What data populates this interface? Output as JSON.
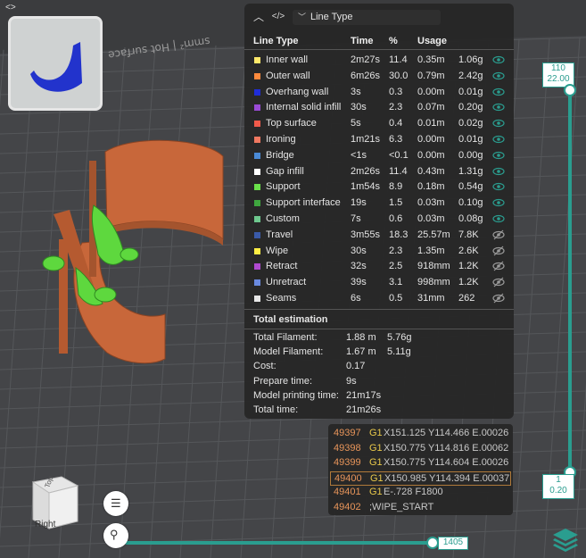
{
  "toolbar": {
    "expand_icon": "expand-icon"
  },
  "panel": {
    "dropdown_label": "Line Type",
    "headers": [
      "Line Type",
      "Time",
      "%",
      "Usage"
    ],
    "rows": [
      {
        "name": "Inner wall",
        "time": "2m27s",
        "pct": "11.4",
        "len": "0.35m",
        "weight": "1.06g",
        "color": "#ffe86a",
        "visible": true
      },
      {
        "name": "Outer wall",
        "time": "6m26s",
        "pct": "30.0",
        "len": "0.79m",
        "weight": "2.42g",
        "color": "#ff8a3d",
        "visible": true
      },
      {
        "name": "Overhang wall",
        "time": "3s",
        "pct": "0.3",
        "len": "0.00m",
        "weight": "0.01g",
        "color": "#1f2dd8",
        "visible": true
      },
      {
        "name": "Internal solid infill",
        "time": "30s",
        "pct": "2.3",
        "len": "0.07m",
        "weight": "0.20g",
        "color": "#9a4bd6",
        "visible": true
      },
      {
        "name": "Top surface",
        "time": "5s",
        "pct": "0.4",
        "len": "0.01m",
        "weight": "0.02g",
        "color": "#f05a4a",
        "visible": true
      },
      {
        "name": "Ironing",
        "time": "1m21s",
        "pct": "6.3",
        "len": "0.00m",
        "weight": "0.01g",
        "color": "#f07860",
        "visible": true
      },
      {
        "name": "Bridge",
        "time": "<1s",
        "pct": "<0.1",
        "len": "0.00m",
        "weight": "0.00g",
        "color": "#4a8ad6",
        "visible": true
      },
      {
        "name": "Gap infill",
        "time": "2m26s",
        "pct": "11.4",
        "len": "0.43m",
        "weight": "1.31g",
        "color": "#ffffff",
        "visible": true
      },
      {
        "name": "Support",
        "time": "1m54s",
        "pct": "8.9",
        "len": "0.18m",
        "weight": "0.54g",
        "color": "#6ae04a",
        "visible": true
      },
      {
        "name": "Support interface",
        "time": "19s",
        "pct": "1.5",
        "len": "0.03m",
        "weight": "0.10g",
        "color": "#3fa63f",
        "visible": true
      },
      {
        "name": "Custom",
        "time": "7s",
        "pct": "0.6",
        "len": "0.03m",
        "weight": "0.08g",
        "color": "#6ec88e",
        "visible": true
      },
      {
        "name": "Travel",
        "time": "3m55s",
        "pct": "18.3",
        "len": "25.57m",
        "weight": "7.8K",
        "color": "#3a5aa8",
        "visible": false
      },
      {
        "name": "Wipe",
        "time": "30s",
        "pct": "2.3",
        "len": "1.35m",
        "weight": "2.6K",
        "color": "#ffee44",
        "visible": false
      },
      {
        "name": "Retract",
        "time": "32s",
        "pct": "2.5",
        "len": "918mm",
        "weight": "1.2K",
        "color": "#b04ad0",
        "visible": false
      },
      {
        "name": "Unretract",
        "time": "39s",
        "pct": "3.1",
        "len": "998mm",
        "weight": "1.2K",
        "color": "#6a8ae0",
        "visible": false
      },
      {
        "name": "Seams",
        "time": "6s",
        "pct": "0.5",
        "len": "31mm",
        "weight": "262",
        "color": "#e8e8e8",
        "visible": false
      }
    ],
    "estimation_title": "Total estimation",
    "estimation": [
      {
        "label": "Total Filament:",
        "v1": "1.88 m",
        "v2": "5.76g"
      },
      {
        "label": "Model Filament:",
        "v1": "1.67 m",
        "v2": "5.11g"
      },
      {
        "label": "Cost:",
        "v1": "0.17",
        "v2": ""
      },
      {
        "label": "Prepare time:",
        "v1": "9s",
        "v2": ""
      },
      {
        "label": "Model printing time:",
        "v1": "21m17s",
        "v2": ""
      },
      {
        "label": "Total time:",
        "v1": "21m26s",
        "v2": ""
      }
    ]
  },
  "gcode": [
    {
      "line": "49397",
      "cmd": "G1",
      "args": "X151.125 Y114.466 E.00026",
      "selected": false
    },
    {
      "line": "49398",
      "cmd": "G1",
      "args": "X150.775 Y114.816 E.00062",
      "selected": false
    },
    {
      "line": "49399",
      "cmd": "G1",
      "args": "X150.775 Y114.604 E.00026",
      "selected": false
    },
    {
      "line": "49400",
      "cmd": "G1",
      "args": "X150.985 Y114.394 E.00037",
      "selected": true
    },
    {
      "line": "49401",
      "cmd": "G1",
      "args": "E-.728 F1800",
      "selected": false
    },
    {
      "line": "49402",
      "cmd": "",
      "args": ";WIPE_START",
      "selected": false
    }
  ],
  "vslider": {
    "top_layer": "110",
    "top_height": "22.00",
    "bottom_layer": "1",
    "bottom_height": "0.20"
  },
  "hslider": {
    "value": "1405"
  },
  "viewcube": {
    "front": "Right",
    "top": "Top"
  },
  "colors": {
    "accent": "#2a9d8f",
    "panel": "#262626",
    "line_num": "#e8955a",
    "cmd": "#e8c84a"
  }
}
